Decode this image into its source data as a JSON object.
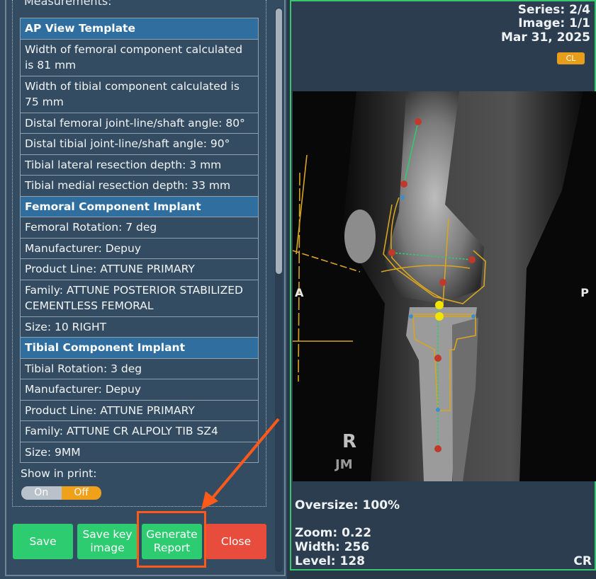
{
  "panel": {
    "section_title": "Measurements:",
    "rows": [
      {
        "text": "AP View Template",
        "head": true
      },
      {
        "text": "Width of femoral component calculated is 81 mm"
      },
      {
        "text": "Width of tibial component calculated is 75 mm"
      },
      {
        "text": "Distal femoral joint-line/shaft angle: 80°"
      },
      {
        "text": "Distal tibial joint-line/shaft angle: 90°"
      },
      {
        "text": "Tibial lateral resection depth: 3 mm"
      },
      {
        "text": "Tibial medial resection depth: 33 mm"
      },
      {
        "text": "Femoral Component Implant",
        "head": true
      },
      {
        "text": "Femoral Rotation: 7 deg"
      },
      {
        "text": "Manufacturer: Depuy"
      },
      {
        "text": "Product Line: ATTUNE PRIMARY"
      },
      {
        "text": "Family: ATTUNE POSTERIOR STABILIZED CEMENTLESS FEMORAL"
      },
      {
        "text": "Size: 10 RIGHT"
      },
      {
        "text": "Tibial Component Implant",
        "head": true
      },
      {
        "text": "Tibial Rotation: 3 deg"
      },
      {
        "text": "Manufacturer: Depuy"
      },
      {
        "text": "Product Line: ATTUNE PRIMARY"
      },
      {
        "text": "Family: ATTUNE CR ALPOLY TIB SZ4"
      },
      {
        "text": "Size: 9MM"
      }
    ],
    "show_in_print_label": "Show in print:",
    "toggle": {
      "on_label": "On",
      "off_label": "Off",
      "selected": "Off"
    }
  },
  "buttons": {
    "save": "Save",
    "save_key_image_line1": "Save key",
    "save_key_image_line2": "image",
    "generate_report_line1": "Generate",
    "generate_report_line2": "Report",
    "close": "Close"
  },
  "viewer": {
    "series": "Series: 2/4",
    "image": "Image: 1/1",
    "date": "Mar 31, 2025",
    "badge": "CL",
    "orient_left": "A",
    "orient_right": "P",
    "marker_r": "R",
    "marker_initials": "JM",
    "oversize": "Oversize: 100%",
    "zoom": "Zoom: 0.22",
    "width": "Width: 256",
    "level": "Level: 128",
    "modality": "CR"
  },
  "colors": {
    "accent_green": "#2ecc71",
    "close_red": "#e74c3c",
    "table_header": "#2f6e9f",
    "toggle_off": "#f0a019",
    "annotation_orange": "#ff5a1a",
    "template_gold": "#d9a520"
  }
}
